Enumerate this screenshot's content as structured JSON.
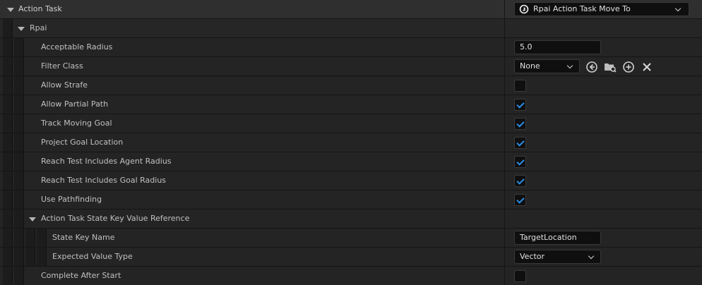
{
  "header": {
    "category_label": "Action Task",
    "class_picker_value": "Rpai Action Task Move To"
  },
  "group": {
    "label": "Rpai"
  },
  "properties": {
    "acceptable_radius": {
      "label": "Acceptable Radius",
      "value": "5.0"
    },
    "filter_class": {
      "label": "Filter Class",
      "value": "None"
    },
    "allow_strafe": {
      "label": "Allow Strafe",
      "checked": false
    },
    "allow_partial_path": {
      "label": "Allow Partial Path",
      "checked": true
    },
    "track_moving_goal": {
      "label": "Track Moving Goal",
      "checked": true
    },
    "project_goal_location": {
      "label": "Project Goal Location",
      "checked": true
    },
    "reach_agent_radius": {
      "label": "Reach Test Includes Agent Radius",
      "checked": true
    },
    "reach_goal_radius": {
      "label": "Reach Test Includes Goal Radius",
      "checked": true
    },
    "use_pathfinding": {
      "label": "Use Pathfinding",
      "checked": true
    },
    "state_key_ref": {
      "label": "Action Task State Key Value Reference",
      "state_key_name": {
        "label": "State Key Name",
        "value": "TargetLocation"
      },
      "expected_value_type": {
        "label": "Expected Value Type",
        "value": "Vector"
      }
    },
    "complete_after_start": {
      "label": "Complete After Start",
      "checked": false
    }
  },
  "icons": {
    "browse": "browse-arrow-icon",
    "folder": "folder-search-icon",
    "add": "plus-circle-icon",
    "clear": "close-icon",
    "class": "unreal-logo-icon"
  },
  "colors": {
    "check": "#2a8ee6",
    "background": "#242424",
    "category": "#2f2f2f"
  }
}
